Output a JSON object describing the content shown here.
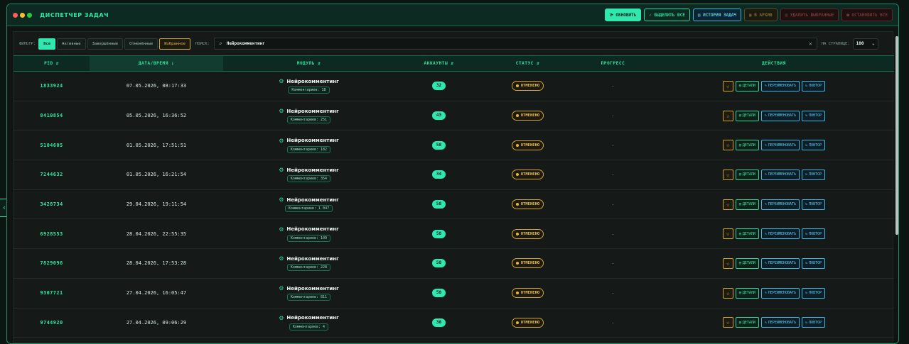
{
  "window": {
    "title": "ДИСПЕТЧЕР ЗАДАЧ",
    "dots": [
      "#ff5f57",
      "#febc2e",
      "#28c840"
    ],
    "actions": {
      "refresh": "⟳ ОБНОВИТЬ",
      "select_all": "✓ ВЫДЕЛИТЬ ВСЕ",
      "history": "▤ ИСТОРИЯ ЗАДАЧ",
      "archive": "▣ В АРХИВ",
      "delete": "▥ УДАЛИТЬ ВЫБРАННЫЕ",
      "stop_all": "■ ОСТАНОВИТЬ ВСЕ"
    }
  },
  "filters": {
    "label": "ФИЛЬТР:",
    "buttons": [
      "Все",
      "Активные",
      "Завершённые",
      "Отменённые",
      "Избранное"
    ],
    "active": "Все"
  },
  "search": {
    "label": "ПОИСК:",
    "value": "Нейрокомментинг",
    "icon": "search-icon",
    "clear_icon": "close-icon"
  },
  "per_page": {
    "label": "НА СТРАНИЦЕ:",
    "value": "100"
  },
  "columns": {
    "pid": "PID",
    "datetime": "ДАТА/ВРЕМЯ",
    "module": "МОДУЛЬ",
    "accounts": "АККАУНТЫ",
    "status": "СТАТУС",
    "progress": "ПРОГРЕСС",
    "actions": "ДЕЙСТВИЯ"
  },
  "sort_icons": {
    "unsorted": "⇵",
    "desc": "↓"
  },
  "row_actions": {
    "details": "ДЕТАЛИ",
    "rename": "ПЕРЕИМЕНОВАТЬ",
    "repeat": "ПОВТОР"
  },
  "rows": [
    {
      "pid": "1833924",
      "date": "07.05.2026, 08:17:33",
      "module": "Нейрокомментинг",
      "comments": "Комментариев: 18",
      "accounts": "32",
      "status": "ОТМЕНЕНО",
      "progress": "-"
    },
    {
      "pid": "8410854",
      "date": "05.05.2026, 16:36:52",
      "module": "Нейрокомментинг",
      "comments": "Комментариев: 251",
      "accounts": "43",
      "status": "ОТМЕНЕНО",
      "progress": "-"
    },
    {
      "pid": "5104605",
      "date": "01.05.2026, 17:51:51",
      "module": "Нейрокомментинг",
      "comments": "Комментариев: 182",
      "accounts": "58",
      "status": "ОТМЕНЕНО",
      "progress": "-"
    },
    {
      "pid": "7244632",
      "date": "01.05.2026, 16:21:54",
      "module": "Нейрокомментинг",
      "comments": "Комментариев: 354",
      "accounts": "34",
      "status": "ОТМЕНЕНО",
      "progress": "-"
    },
    {
      "pid": "3428734",
      "date": "29.04.2026, 19:11:54",
      "module": "Нейрокомментинг",
      "comments": "Комментариев: 1 047",
      "accounts": "58",
      "status": "ОТМЕНЕНО",
      "progress": "-"
    },
    {
      "pid": "6928553",
      "date": "28.04.2026, 22:55:35",
      "module": "Нейрокомментинг",
      "comments": "Комментариев: 109",
      "accounts": "58",
      "status": "ОТМЕНЕНО",
      "progress": "-"
    },
    {
      "pid": "7829096",
      "date": "28.04.2026, 17:53:28",
      "module": "Нейрокомментинг",
      "comments": "Комментариев: 228",
      "accounts": "58",
      "status": "ОТМЕНЕНО",
      "progress": "-"
    },
    {
      "pid": "9307721",
      "date": "27.04.2026, 16:05:47",
      "module": "Нейрокомментинг",
      "comments": "Комментариев: 811",
      "accounts": "58",
      "status": "ОТМЕНЕНО",
      "progress": "-"
    },
    {
      "pid": "9744920",
      "date": "27.04.2026, 09:06:29",
      "module": "Нейрокомментинг",
      "comments": "Комментариев: 4",
      "accounts": "30",
      "status": "ОТМЕНЕНО",
      "progress": "-"
    }
  ]
}
